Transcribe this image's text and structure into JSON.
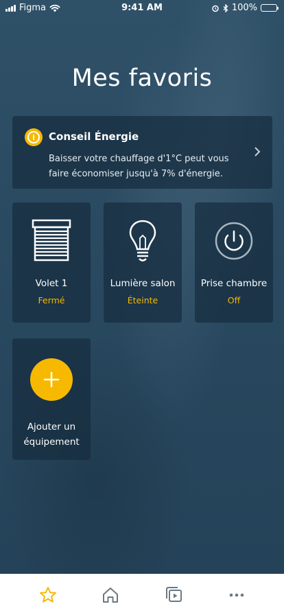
{
  "status_bar": {
    "carrier": "Figma",
    "time": "9:41 AM",
    "battery": "100%"
  },
  "header": {
    "title": "Mes favoris"
  },
  "energy_tip": {
    "title": "Conseil Énergie",
    "text": "Baisser votre chauffage d'1°C peut vous faire économiser jusqu'à 7% d'énergie.",
    "icon": "info-icon"
  },
  "devices": [
    {
      "name": "Volet 1",
      "state": "Fermé",
      "icon": "shutter-icon"
    },
    {
      "name": "Lumière salon",
      "state": "Éteinte",
      "icon": "lightbulb-icon"
    },
    {
      "name": "Prise chambre",
      "state": "Off",
      "icon": "power-icon"
    }
  ],
  "add_device": {
    "label": "Ajouter un équipement",
    "icon": "plus-icon"
  },
  "tabbar": {
    "items": [
      {
        "icon": "star-icon",
        "active": true
      },
      {
        "icon": "home-icon",
        "active": false
      },
      {
        "icon": "media-icon",
        "active": false
      },
      {
        "icon": "more-icon",
        "active": false
      }
    ]
  },
  "colors": {
    "accent": "#f6b900",
    "background": "#2b4a60",
    "card": "#162d3e"
  }
}
